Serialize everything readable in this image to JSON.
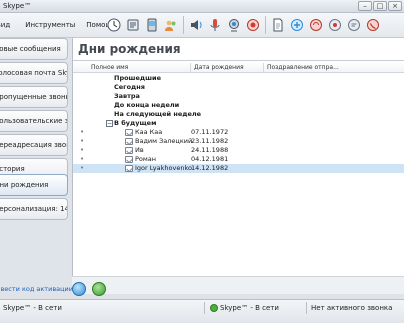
{
  "window": {
    "title": "Skype™"
  },
  "menu": {
    "items": [
      "Вид",
      "Инструменты",
      "Помощь"
    ]
  },
  "toolbar": {
    "buttons": [
      "clock-icon",
      "contacts-icon",
      "sms-icon",
      "users-icon",
      "sound-icon",
      "microphone-icon",
      "webcam-icon",
      "record-icon",
      "document-icon",
      "add-contact-icon",
      "sync-icon",
      "stop-icon",
      "chat-icon",
      "call-icon"
    ]
  },
  "sidebar": {
    "items": [
      {
        "label": "Новые сообщения"
      },
      {
        "label": "Голосовая почта Skype"
      },
      {
        "label": "Пропущенные звонки"
      },
      {
        "label": "Пользовательские записи"
      },
      {
        "label": "Переадресация звонков"
      },
      {
        "label": "История"
      },
      {
        "label": "Дни рождения",
        "active": true
      },
      {
        "label": "Персонализация: 145"
      }
    ],
    "activate_link": "Ввести код активации"
  },
  "main": {
    "heading": "Дни рождения",
    "columns": [
      "Полное имя",
      "Дата рождения",
      "Поздравление отпра..."
    ],
    "groups": [
      "Прошедшие",
      "Сегодня",
      "Завтра",
      "До конца недели",
      "На следующей неделе",
      "В будущем"
    ],
    "future_expander": "−",
    "contacts": [
      {
        "name": "Каа Каа",
        "date": "07.11.1972",
        "selected": false
      },
      {
        "name": "Вадим Залецкий",
        "date": "23.11.1982",
        "selected": false
      },
      {
        "name": "Ив",
        "date": "24.11.1988",
        "selected": false
      },
      {
        "name": "Роман",
        "date": "04.12.1981",
        "selected": false
      },
      {
        "name": "Igor Lyakhovenko",
        "date": "14.12.1982",
        "selected": true
      }
    ]
  },
  "status": {
    "left": "Skype™ - В сети",
    "middle": "Skype™ - В сети",
    "right": "Нет активного звонка"
  },
  "colors": {
    "accent": "#1f5fb8",
    "selection": "#cfe3f7",
    "online": "#4cae3c"
  }
}
